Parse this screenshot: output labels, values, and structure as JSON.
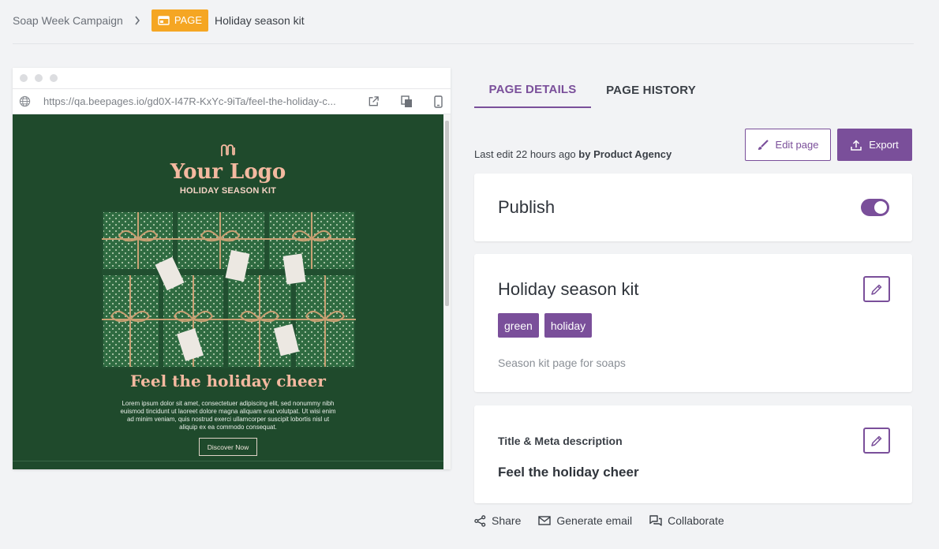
{
  "breadcrumb": {
    "campaign": "Soap Week Campaign",
    "badge": "PAGE",
    "current": "Holiday season kit"
  },
  "preview": {
    "url": "https://qa.beepages.io/gd0X-I47R-KxYc-9iTa/feel-the-holiday-c...",
    "site": {
      "logo": "Your Logo",
      "subtitle": "HOLIDAY SEASON KIT",
      "headline": "Feel the holiday cheer",
      "body": "Lorem ipsum dolor sit amet, consectetuer adipiscing elit, sed nonummy nibh euismod tincidunt ut laoreet dolore magna aliquam erat volutpat. Ut wisi enim ad minim veniam, quis nostrud exerci ullamcorper suscipit lobortis nisl ut aliquip ex ea commodo consequat.",
      "cta": "Discover Now"
    }
  },
  "tabs": {
    "details": "PAGE DETAILS",
    "history": "PAGE HISTORY"
  },
  "last_edit": {
    "text": "Last edit 22 hours ago",
    "by": "by Product Agency"
  },
  "actions": {
    "edit": "Edit page",
    "export": "Export"
  },
  "publish": {
    "label": "Publish",
    "enabled": true
  },
  "page": {
    "title": "Holiday season kit",
    "tags": [
      "green",
      "holiday"
    ],
    "description": "Season kit page for soaps"
  },
  "meta": {
    "label": "Title & Meta description",
    "value": "Feel the holiday cheer"
  },
  "footer": {
    "share": "Share",
    "generate_email": "Generate email",
    "collaborate": "Collaborate"
  },
  "colors": {
    "accent": "#7a4f9a",
    "badge": "#f5a623",
    "site_bg": "#1f4a2c",
    "site_title": "#f4b9a0"
  },
  "icons": [
    "chevron-right-icon",
    "page-icon",
    "globe-icon",
    "external-link-icon",
    "copy-icon",
    "mobile-icon",
    "brush-icon",
    "upload-icon",
    "pencil-icon",
    "share-icon",
    "mail-icon",
    "chat-icon"
  ]
}
